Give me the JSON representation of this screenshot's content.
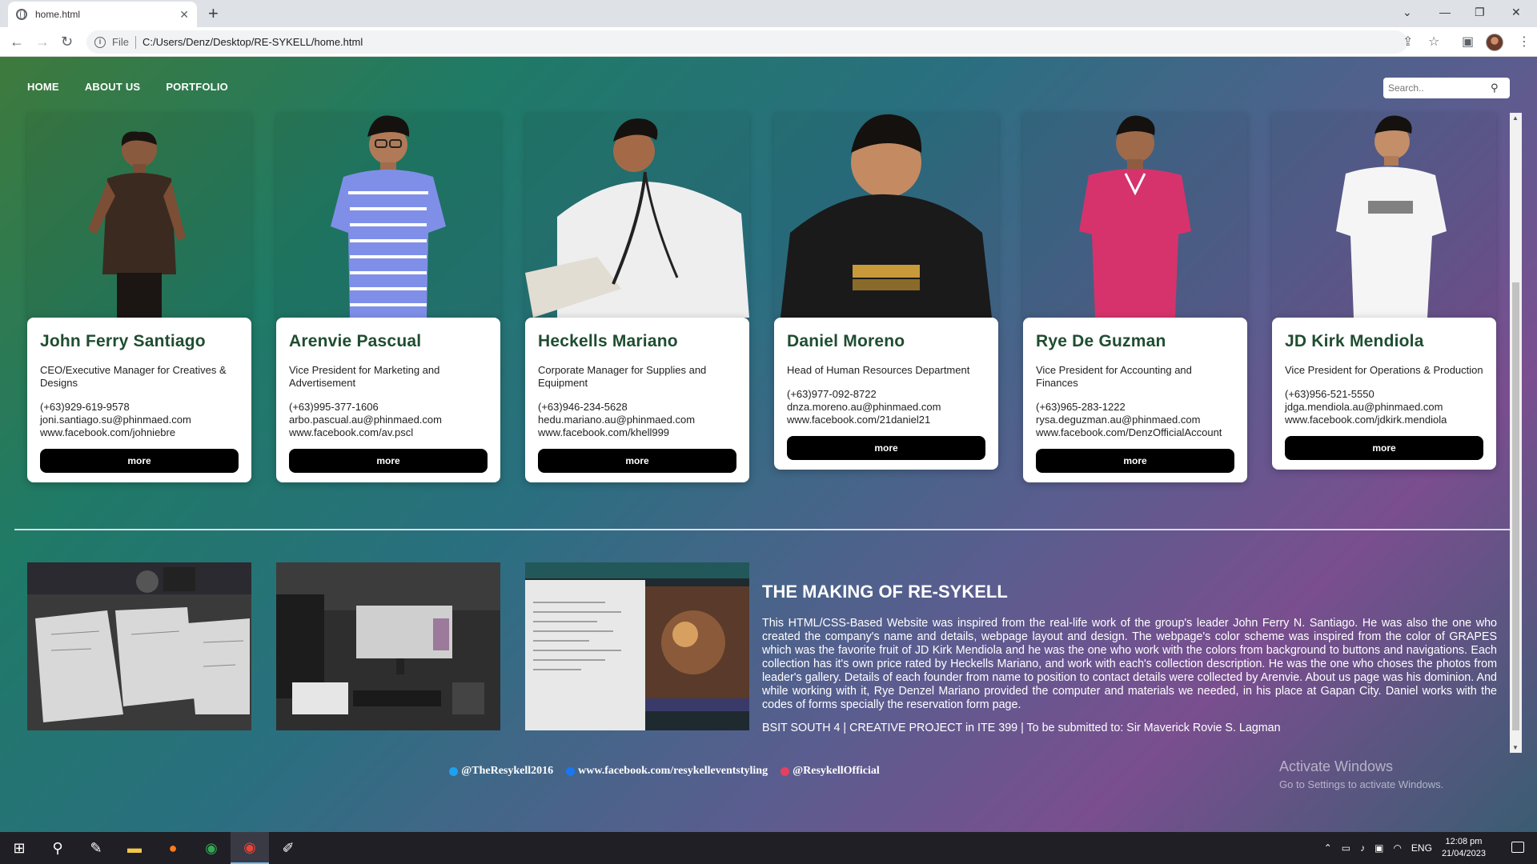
{
  "browser": {
    "tab_title": "home.html",
    "new_tab": "+",
    "url_scheme_label": "File",
    "url": "C:/Users/Denz/Desktop/RE-SYKELL/home.html"
  },
  "nav": {
    "items": [
      "HOME",
      "ABOUT US",
      "PORTFOLIO"
    ],
    "search_placeholder": "Search.."
  },
  "team": [
    {
      "name": "John Ferry Santiago",
      "role": "CEO/Executive Manager for Creatives & Designs",
      "phone": "(+63)929-619-9578",
      "email": "joni.santiago.su@phinmaed.com",
      "facebook": "www.facebook.com/johniebre",
      "button": "more",
      "shirt": "#3b2a20"
    },
    {
      "name": "Arenvie Pascual",
      "role": "Vice President for Marketing and Advertisement",
      "phone": "(+63)995-377-1606",
      "email": "arbo.pascual.au@phinmaed.com",
      "facebook": "www.facebook.com/av.pscl",
      "button": "more",
      "shirt": "#7f8fe8"
    },
    {
      "name": "Heckells Mariano",
      "role": "Corporate Manager for Supplies and Equipment",
      "phone": "(+63)946-234-5628",
      "email": "hedu.mariano.au@phinmaed.com",
      "facebook": "www.facebook.com/khell999",
      "button": "more",
      "shirt": "#eeeeee"
    },
    {
      "name": "Daniel Moreno",
      "role": "Head of Human Resources Department",
      "phone": "(+63)977-092-8722",
      "email": "dnza.moreno.au@phinmaed.com",
      "facebook": "www.facebook.com/21daniel21",
      "button": "more",
      "shirt": "#1a1a1a"
    },
    {
      "name": "Rye De Guzman",
      "role": "Vice President for Accounting and Finances",
      "phone": "(+63)965-283-1222",
      "email": "rysa.deguzman.au@phinmaed.com",
      "facebook": "www.facebook.com/DenzOfficialAccount",
      "button": "more",
      "shirt": "#d6336c"
    },
    {
      "name": "JD Kirk Mendiola",
      "role": "Vice President for Operations & Production",
      "phone": "(+63)956-521-5550",
      "email": "jdga.mendiola.au@phinmaed.com",
      "facebook": "www.facebook.com/jdkirk.mendiola",
      "button": "more",
      "shirt": "#f5f5f5"
    }
  ],
  "making": {
    "title": "THE MAKING OF RE-SYKELL",
    "body": "This HTML/CSS-Based Website was inspired from the real-life work of the group's leader John Ferry N. Santiago. He was also the one who created the company's name and details, webpage layout and design. The webpage's color scheme was inspired from the color of GRAPES which was the favorite fruit of JD Kirk Mendiola and he was the one who work with the colors from background to buttons and navigations. Each collection has it's own price rated by Heckells Mariano, and work with each's collection description. He was the one who choses the photos from leader's gallery. Details of each founder from name to position to contact details were collected by Arenvie. About us page was his dominion. And while working with it, Rye Denzel Mariano provided the computer and materials we needed, in his place at Gapan City. Daniel works with the codes of forms specially the reservation form page.",
    "credit": "BSIT SOUTH 4 | CREATIVE PROJECT in ITE 399 | To be submitted to: Sir Maverick Rovie S. Lagman"
  },
  "social": {
    "twitter": "@TheResykell2016",
    "facebook": "www.facebook.com/resykelleventstyling",
    "instagram": "@ResykellOfficial"
  },
  "watermark": {
    "line1": "Activate Windows",
    "line2": "Go to Settings to activate Windows."
  },
  "taskbar": {
    "lang": "ENG",
    "time": "12:08 pm",
    "date": "21/04/2023"
  },
  "colors": {
    "accent_name": "#1f4d30",
    "button": "#000000"
  }
}
